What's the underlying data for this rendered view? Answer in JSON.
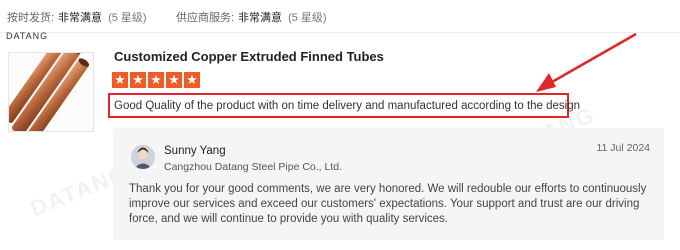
{
  "ratings": {
    "shipping": {
      "label": "按时发货:",
      "value": "非常满意",
      "level": "(5 星级)"
    },
    "service": {
      "label": "供应商服务:",
      "value": "非常满意",
      "level": "(5 星级)"
    }
  },
  "brand_small": "DATANG",
  "watermark_text": "DATANG",
  "product": {
    "title": "Customized Copper Extruded Finned Tubes",
    "stars": [
      "★",
      "★",
      "★",
      "★",
      "★"
    ],
    "review": "Good Quality of the product with on time delivery and manufactured according to the design"
  },
  "reply": {
    "name": "Sunny Yang",
    "company": "Cangzhou Datang Steel Pipe Co., Ltd.",
    "date": "11 Jul 2024",
    "body": "Thank you for your good comments, we are very honored. We will redouble our efforts to continuously improve our services and exceed our customers' expectations. Your support and trust are our driving force, and we will continue to provide you with quality services."
  },
  "colors": {
    "star": "#f05a24",
    "highlight": "#e0262b",
    "card_bg": "#f5f5f5"
  },
  "icons": [
    "avatar-icon",
    "copper-tubes-image",
    "annotation-arrow-icon"
  ]
}
